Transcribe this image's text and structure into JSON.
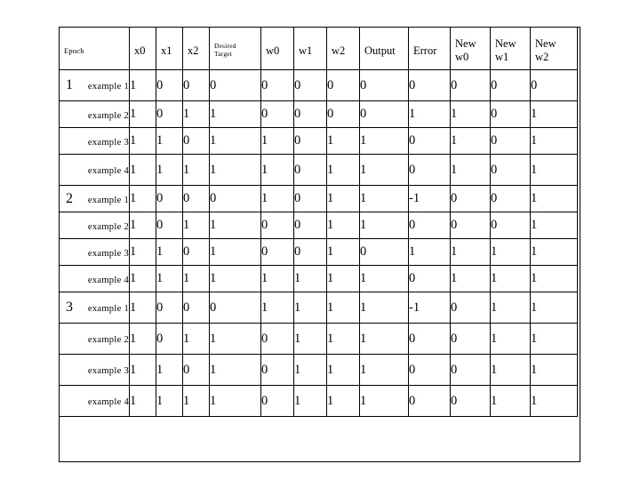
{
  "table": {
    "headers": [
      {
        "id": "epoch",
        "label": "Epoch",
        "line2": "",
        "size": "small"
      },
      {
        "id": "x0",
        "label": "x0",
        "line2": "",
        "size": "normal"
      },
      {
        "id": "x1",
        "label": "x1",
        "line2": "",
        "size": "normal"
      },
      {
        "id": "x2",
        "label": "x2",
        "line2": "",
        "size": "normal"
      },
      {
        "id": "target",
        "label": "Desired",
        "line2": "Target",
        "size": "tiny"
      },
      {
        "id": "w0",
        "label": "w0",
        "line2": "",
        "size": "normal"
      },
      {
        "id": "w1",
        "label": "w1",
        "line2": "",
        "size": "normal"
      },
      {
        "id": "w2",
        "label": "w2",
        "line2": "",
        "size": "normal"
      },
      {
        "id": "output",
        "label": "Output",
        "line2": "",
        "size": "normal"
      },
      {
        "id": "error",
        "label": "Error",
        "line2": "",
        "size": "normal"
      },
      {
        "id": "new_w0",
        "label": "New",
        "line2": "w0",
        "size": "normal"
      },
      {
        "id": "new_w1",
        "label": "New",
        "line2": "w1",
        "size": "normal"
      },
      {
        "id": "new_w2",
        "label": "New",
        "line2": "w2",
        "size": "normal"
      }
    ],
    "rows": [
      {
        "epoch": "1",
        "example": "example 1",
        "x0": "1",
        "x1": "0",
        "x2": "0",
        "target": "0",
        "w0": "0",
        "w1": "0",
        "w2": "0",
        "output": "0",
        "error": "0",
        "new_w0": "0",
        "new_w1": "0",
        "new_w2": "0"
      },
      {
        "epoch": "",
        "example": "example 2",
        "x0": "1",
        "x1": "0",
        "x2": "1",
        "target": "1",
        "w0": "0",
        "w1": "0",
        "w2": "0",
        "output": "0",
        "error": "1",
        "new_w0": "1",
        "new_w1": "0",
        "new_w2": "1"
      },
      {
        "epoch": "",
        "example": "example 3",
        "x0": "1",
        "x1": "1",
        "x2": "0",
        "target": "1",
        "w0": "1",
        "w1": "0",
        "w2": "1",
        "output": "1",
        "error": "0",
        "new_w0": "1",
        "new_w1": "0",
        "new_w2": "1"
      },
      {
        "epoch": "",
        "example": "example 4",
        "x0": "1",
        "x1": "1",
        "x2": "1",
        "target": "1",
        "w0": "1",
        "w1": "0",
        "w2": "1",
        "output": "1",
        "error": "0",
        "new_w0": "1",
        "new_w1": "0",
        "new_w2": "1"
      },
      {
        "epoch": "2",
        "example": "example 1",
        "x0": "1",
        "x1": "0",
        "x2": "0",
        "target": "0",
        "w0": "1",
        "w1": "0",
        "w2": "1",
        "output": "1",
        "error": "-1",
        "new_w0": "0",
        "new_w1": "0",
        "new_w2": "1"
      },
      {
        "epoch": "",
        "example": "example 2",
        "x0": "1",
        "x1": "0",
        "x2": "1",
        "target": "1",
        "w0": "0",
        "w1": "0",
        "w2": "1",
        "output": "1",
        "error": "0",
        "new_w0": "0",
        "new_w1": "0",
        "new_w2": "1"
      },
      {
        "epoch": "",
        "example": "example 3",
        "x0": "1",
        "x1": "1",
        "x2": "0",
        "target": "1",
        "w0": "0",
        "w1": "0",
        "w2": "1",
        "output": "0",
        "error": "1",
        "new_w0": "1",
        "new_w1": "1",
        "new_w2": "1"
      },
      {
        "epoch": "",
        "example": "example 4",
        "x0": "1",
        "x1": "1",
        "x2": "1",
        "target": "1",
        "w0": "1",
        "w1": "1",
        "w2": "1",
        "output": "1",
        "error": "0",
        "new_w0": "1",
        "new_w1": "1",
        "new_w2": "1"
      },
      {
        "epoch": "3",
        "example": "example 1",
        "x0": "1",
        "x1": "0",
        "x2": "0",
        "target": "0",
        "w0": "1",
        "w1": "1",
        "w2": "1",
        "output": "1",
        "error": "-1",
        "new_w0": "0",
        "new_w1": "1",
        "new_w2": "1"
      },
      {
        "epoch": "",
        "example": "example 2",
        "x0": "1",
        "x1": "0",
        "x2": "1",
        "target": "1",
        "w0": "0",
        "w1": "1",
        "w2": "1",
        "output": "1",
        "error": "0",
        "new_w0": "0",
        "new_w1": "1",
        "new_w2": "1"
      },
      {
        "epoch": "",
        "example": "example 3",
        "x0": "1",
        "x1": "1",
        "x2": "0",
        "target": "1",
        "w0": "0",
        "w1": "1",
        "w2": "1",
        "output": "1",
        "error": "0",
        "new_w0": "0",
        "new_w1": "1",
        "new_w2": "1"
      },
      {
        "epoch": "",
        "example": "example 4",
        "x0": "1",
        "x1": "1",
        "x2": "1",
        "target": "1",
        "w0": "0",
        "w1": "1",
        "w2": "1",
        "output": "1",
        "error": "0",
        "new_w0": "0",
        "new_w1": "1",
        "new_w2": "1"
      }
    ]
  }
}
